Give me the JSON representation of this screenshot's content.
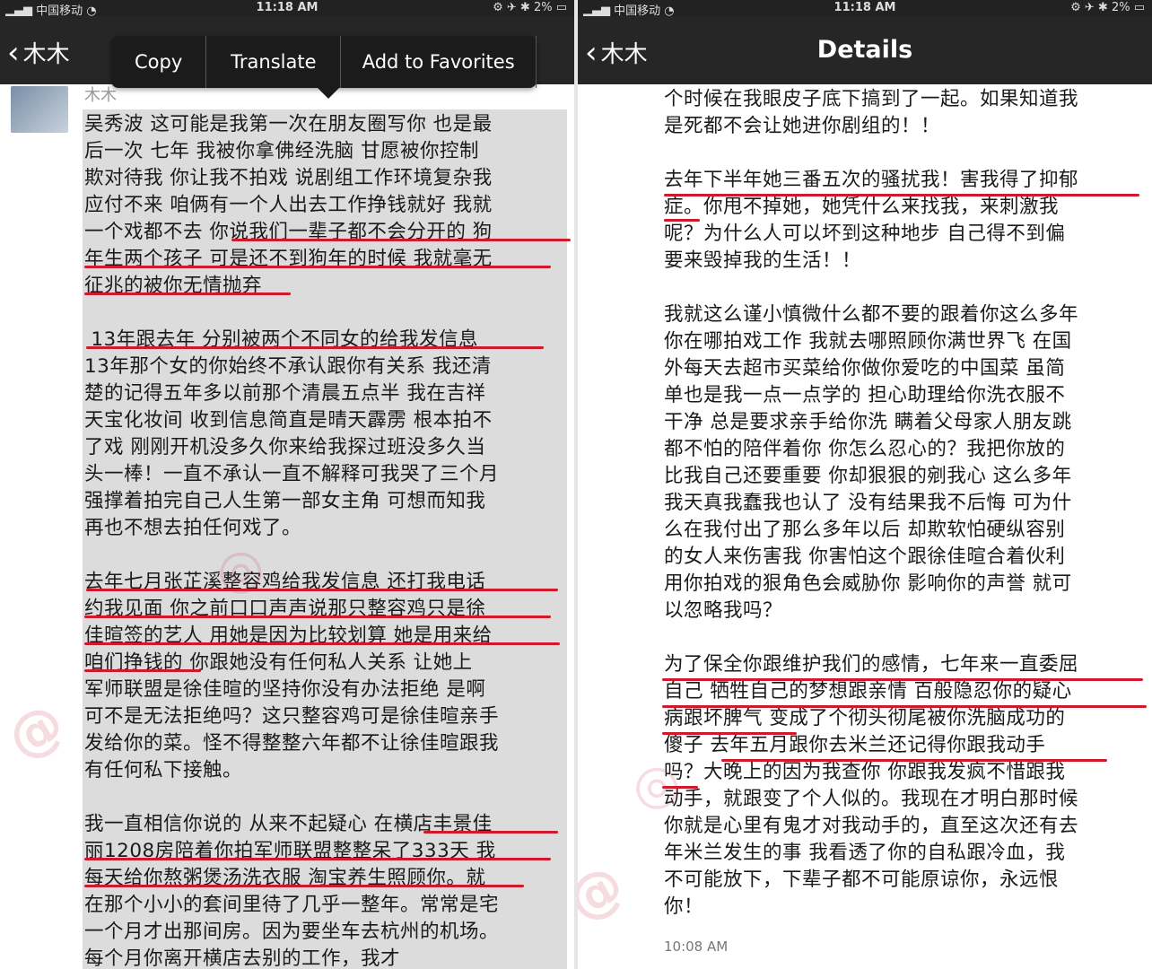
{
  "left": {
    "status": {
      "carrier": "中国移动",
      "time": "11:18 AM",
      "battery": "2%"
    },
    "nav": {
      "back_label": "木木"
    },
    "context_menu": {
      "items": [
        "Copy",
        "Translate",
        "Add to Favorites"
      ]
    },
    "post": {
      "username": "木木",
      "paragraphs": [
        [
          "吴秀波 这可能是我第一次在朋友圈写你 也是最",
          "后一次 七年 我被你拿佛经洗脑 甘愿被你控制",
          "欺对待我 你让我不拍戏 说剧组工作环境复杂我",
          "应付不来 咱俩有一个人出去工作挣钱就好 我就",
          "一个戏都不去 你说我们一辈子都不会分开的 狗",
          "年生两个孩子 可是还不到狗年的时候 我就毫无",
          "征兆的被你无情抛弃"
        ],
        [
          " 13年跟去年 分别被两个不同女的给我发信息",
          "13年那个女的你始终不承认跟你有关系 我还清",
          "楚的记得五年多以前那个清晨五点半 我在吉祥",
          "天宝化妆间 收到信息简直是晴天霹雳 根本拍不",
          "了戏 刚刚开机没多久你来给我探过班没多久当",
          "头一棒！一直不承认一直不解释可我哭了三个月",
          "强撑着拍完自己人生第一部女主角 可想而知我",
          "再也不想去拍任何戏了。"
        ],
        [
          "去年七月张芷溪整容鸡给我发信息 还打我电话",
          "约我见面 你之前口口声声说那只整容鸡只是徐",
          "佳暄签的艺人 用她是因为比较划算 她是用来给",
          "咱们挣钱的 你跟她没有任何私人关系 让她上",
          "军师联盟是徐佳暄的坚持你没有办法拒绝 是啊",
          "可不是无法拒绝吗？这只整容鸡可是徐佳暄亲手",
          "发给你的菜。怪不得整整六年都不让徐佳暄跟我",
          "有任何私下接触。"
        ],
        [
          "我一直相信你说的 从来不起疑心 在横店丰景佳",
          "丽1208房陪着你拍军师联盟整整呆了333天 我",
          "每天给你熬粥煲汤洗衣服 淘宝养生照顾你。就",
          "在那个小小的套间里待了几乎一整年。常常是宅",
          "一个月才出那间房。因为要坐车去杭州的机场。",
          "每个月你离开横店去别的工作，我才"
        ]
      ]
    }
  },
  "right": {
    "status": {
      "carrier": "中国移动",
      "time": "11:18 AM",
      "battery": "2%"
    },
    "nav": {
      "back_label": "木木",
      "title": "Details"
    },
    "paragraphs": [
      [
        "个时候在我眼皮子底下搞到了一起。如果知道我",
        "是死都不会让她进你剧组的！！"
      ],
      [
        "去年下半年她三番五次的骚扰我！害我得了抑郁",
        "症。你甩不掉她，她凭什么来找我，来刺激我",
        "呢？为什么人可以坏到这种地步 自己得不到偏",
        "要来毁掉我的生活！！"
      ],
      [
        "我就这么谨小慎微什么都不要的跟着你这么多年",
        "你在哪拍戏工作 我就去哪照顾你满世界飞 在国",
        "外每天去超市买菜给你做你爱吃的中国菜 虽简",
        "单也是我一点一点学的 担心助理给你洗衣服不",
        "干净 总是要求亲手给你洗 瞒着父母家人朋友跳",
        "都不怕的陪伴着你 你怎么忍心的？我把你放的",
        "比我自己还要重要 你却狠狠的剜我心 这么多年",
        "我天真我蠢我也认了 没有结果我不后悔 可为什",
        "么在我付出了那么多年以后 却欺软怕硬纵容别",
        "的女人来伤害我 你害怕这个跟徐佳暄合着伙利",
        "用你拍戏的狠角色会威胁你 影响你的声誉 就可",
        "以忽略我吗？"
      ],
      [
        "为了保全你跟维护我们的感情，七年来一直委屈",
        "自己 牺牲自己的梦想跟亲情 百般隐忍你的疑心",
        "病跟坏脾气 变成了个彻头彻尾被你洗脑成功的",
        "傻子 去年五月跟你去米兰还记得你跟我动手",
        "吗？大晚上的因为我查你 你跟我发疯不惜跟我",
        "动手，就跟变了个人似的。我现在才明白那时候",
        "你就是心里有鬼才对我动手的，直至这次还有去",
        "年米兰发生的事 我看透了你的自私跟冷血，我",
        "不可能放下，下辈子都不可能原谅你，永远恨",
        "你！"
      ]
    ],
    "timestamp": "10:08 AM"
  }
}
